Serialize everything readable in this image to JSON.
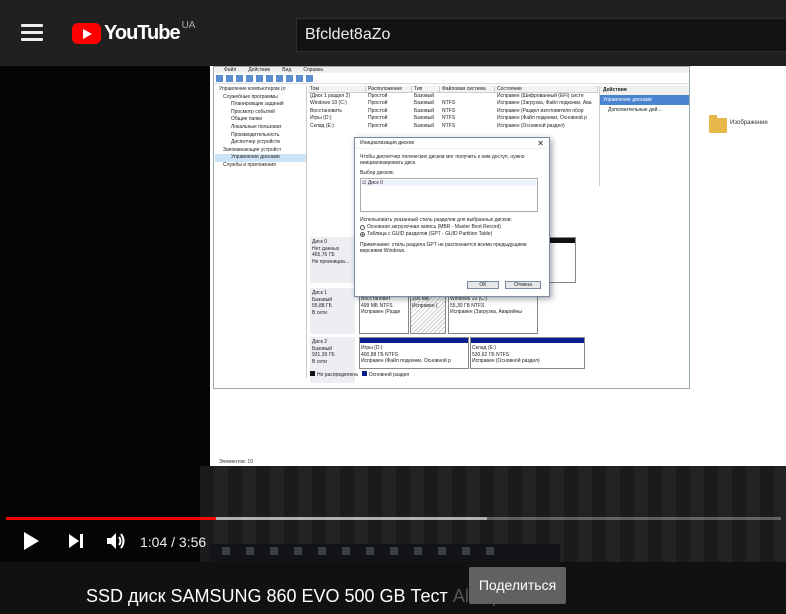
{
  "youtube": {
    "logo_word": "YouTube",
    "country": "UA",
    "search_value": "Bfcldet8aZo"
  },
  "disk_mgmt": {
    "menu": [
      "Файл",
      "Действие",
      "Вид",
      "Справка"
    ],
    "tree": [
      "Управление компьютером (л",
      "Служебные программы",
      "Планировщик заданий",
      "Просмотр событий",
      "Общие папки",
      "Локальные пользоват",
      "Производительность",
      "Диспетчер устройств",
      "Запоминающие устройст",
      "Управление дисками",
      "Службы и приложения"
    ],
    "columns": [
      "Том",
      "Расположение",
      "Тип",
      "Файловая система",
      "Состояние"
    ],
    "volumes": [
      [
        "(Диск 1 раздел 2)",
        "Простой",
        "Базовый",
        "",
        "Исправен (Шифрованный (EFI) систе"
      ],
      [
        "Windows 10 (C:)",
        "Простой",
        "Базовый",
        "NTFS",
        "Исправен (Загрузка, Файл подкачки, Ава"
      ],
      [
        "Восстановить",
        "Простой",
        "Базовый",
        "NTFS",
        "Исправен (Раздел изготовителя обор"
      ],
      [
        "Игры (D:)",
        "Простой",
        "Базовый",
        "NTFS",
        "Исправен (Файл подкачки, Основной р"
      ],
      [
        "Склад (E:)",
        "Простой",
        "Базовый",
        "NTFS",
        "Исправен (Основной раздел)"
      ]
    ],
    "actions_header": "Действия",
    "actions_selected": "Управление дисками",
    "actions_more": "Дополнительные дей...",
    "disk0": [
      "Диск 0",
      "Нет данных",
      "465,76 ГБ",
      "Не проинициа..."
    ],
    "disk1": [
      "Диск 1",
      "Базовый",
      "55,88 ГБ",
      "В сети"
    ],
    "disk2": [
      "Диск 2",
      "Базовый",
      "931,39 ГБ",
      "В сети"
    ],
    "d1p1": [
      "Восстановит",
      "499 МБ NTFS",
      "Исправен (Разде"
    ],
    "d1p2": [
      "100 МБ",
      "Исправен ("
    ],
    "d1p3": [
      "Windows 10  (C:)",
      "55,30 ГБ NTFS",
      "Исправен (Загрузка, Аварийны"
    ],
    "d2p1": [
      "Игры (D:)",
      "400,88 ГБ NTFS",
      "Исправен (Файл подкачки, Основной р"
    ],
    "d2p2": [
      "Склад (E:)",
      "530,62 ГБ NTFS",
      "Исправен (Основной раздел)"
    ],
    "legend": [
      "Не распределена",
      "Основной раздел"
    ],
    "status_elements": "Элементов: 10"
  },
  "dialog": {
    "title": "Инициализация дисков",
    "desc": "Чтобы диспетчер логических дисков мог получить к ним доступ, нужно инициализировать диск.",
    "select_label": "Выбор дисков:",
    "disk_item": "Диск 0",
    "style_label": "Использовать указанный стиль разделов для выбранных дисков:",
    "option_mbr": "Основная загрузочная запись (MBR - Master Boot Record)",
    "option_gpt": "Таблица с GUID разделов (GPT - GUID Partition Table)",
    "note": "Примечание: стиль раздела GPT не распознается всеми предыдущими версиями Windows.",
    "ok": "OK",
    "cancel": "Отмена"
  },
  "desktop": {
    "folder_label": "Изображение"
  },
  "player": {
    "time_display": "1:04 / 3:56",
    "played_fraction": 0.2712,
    "loaded_fraction": 0.62,
    "title": "SSD диск SAMSUNG 860 EVO 500 GB Тест",
    "title_overflow": "Aliexpress",
    "share_label": "Поделиться"
  }
}
